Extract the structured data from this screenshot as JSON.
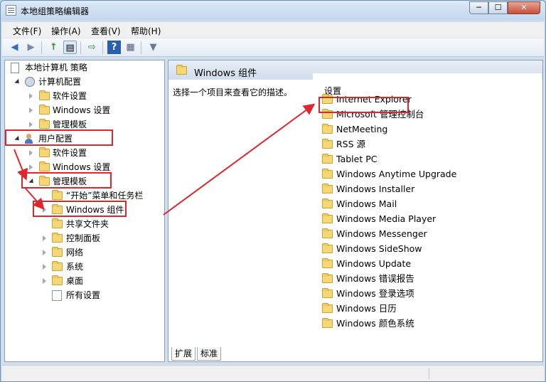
{
  "window": {
    "title": "本地组策略编辑器",
    "min_label": "─",
    "max_label": "☐",
    "close_label": "✕"
  },
  "menu": [
    "文件(F)",
    "操作(A)",
    "查看(V)",
    "帮助(H)"
  ],
  "toolbar": {
    "back": "◀",
    "forward": "▶",
    "up": "↑",
    "show_tree": "▤",
    "export": "⇨",
    "help": "?",
    "properties": "▦",
    "filter": "▼"
  },
  "tree": {
    "root": "本地计算机 策略",
    "computer_config": "计算机配置",
    "cc_software": "软件设置",
    "cc_windows": "Windows 设置",
    "cc_admin": "管理模板",
    "user_config": "用户配置",
    "uc_software": "软件设置",
    "uc_windows": "Windows 设置",
    "uc_admin": "管理模板",
    "start_menu": "“开始”菜单和任务栏",
    "windows_components": "Windows 组件",
    "shared_folders": "共享文件夹",
    "control_panel": "控制面板",
    "network": "网络",
    "system": "系统",
    "desktop": "桌面",
    "all_settings": "所有设置"
  },
  "right": {
    "header_title": "Windows 组件",
    "description": "选择一个项目来查看它的描述。",
    "column_header": "设置",
    "items": [
      "Internet Explorer",
      "Microsoft 管理控制台",
      "NetMeeting",
      "RSS 源",
      "Tablet PC",
      "Windows Anytime Upgrade",
      "Windows Installer",
      "Windows Mail",
      "Windows Media Player",
      "Windows Messenger",
      "Windows SideShow",
      "Windows Update",
      "Windows 错误报告",
      "Windows 登录选项",
      "Windows 日历",
      "Windows 颜色系统"
    ],
    "tabs": [
      "扩展",
      "标准"
    ],
    "active_tab": "扩展"
  },
  "colors": {
    "highlight": "#e0262c",
    "folder": "#f6d776",
    "chrome": "#cfdff0"
  }
}
